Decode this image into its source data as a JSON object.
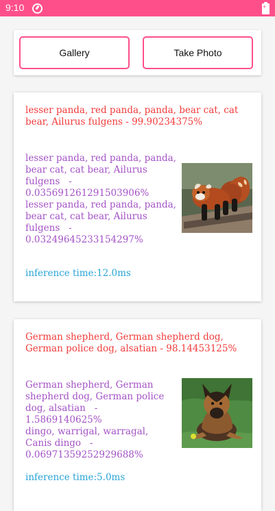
{
  "status_bar": {
    "time": "9:10",
    "app_icon": "circle-arrow-icon",
    "battery_icon": "battery-charging-icon"
  },
  "buttons": {
    "gallery": "Gallery",
    "take_photo": "Take Photo"
  },
  "results": [
    {
      "top_prediction": "lesser panda, red panda, panda, bear cat, cat bear, Ailurus fulgens   - 99.90234375%",
      "other_predictions": [
        "lesser panda, red panda, panda, bear cat, cat bear, Ailurus fulgens   - 0.035691261291503906%",
        "lesser panda, red panda, panda, bear cat, cat bear, Ailurus fulgens   - 0.03249645233154297%"
      ],
      "inference_time": "inference time:12.0ms",
      "image_subject": "red-panda-photo"
    },
    {
      "top_prediction": "German shepherd, German shepherd dog, German police dog, alsatian   - 98.14453125%",
      "other_predictions": [
        "German shepherd, German shepherd dog, German police dog, alsatian   - 1.5869140625%",
        "dingo, warrigal, warragal, Canis dingo   - 0.06971359252929688%"
      ],
      "inference_time": "inference time:5.0ms",
      "image_subject": "german-shepherd-photo"
    }
  ],
  "colors": {
    "accent": "#ff4f8b",
    "top_prediction": "#f23b3b",
    "other_predictions": "#a453c6",
    "inference": "#2aa5d6"
  }
}
